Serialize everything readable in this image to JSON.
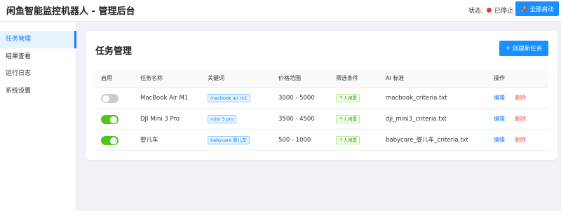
{
  "header": {
    "title": "闲鱼智能监控机器人 - 管理后台",
    "status_label": "状态:",
    "status_value": "已停止",
    "start_all_label": "全部启动",
    "start_icon": "rocket-icon"
  },
  "sidebar": {
    "items": [
      {
        "label": "任务管理",
        "active": true
      },
      {
        "label": "结果查看",
        "active": false
      },
      {
        "label": "运行日志",
        "active": false
      },
      {
        "label": "系统设置",
        "active": false
      }
    ]
  },
  "main": {
    "title": "任务管理",
    "create_label": "创建新任务",
    "columns": [
      "启用",
      "任务名称",
      "关键词",
      "价格范围",
      "筛选条件",
      "AI 标准",
      "操作"
    ],
    "rows": [
      {
        "enabled": false,
        "name": "MacBook Air M1",
        "keyword": "macbook air m1",
        "price": "3000 - 5000",
        "filter": "个人闲置",
        "ai": "macbook_criteria.txt",
        "edit": "编辑",
        "delete": "删除"
      },
      {
        "enabled": true,
        "name": "DJI Mini 3 Pro",
        "keyword": "mini 3 pro",
        "price": "3500 - 4500",
        "filter": "个人闲置",
        "ai": "dji_mini3_criteria.txt",
        "edit": "编辑",
        "delete": "删除"
      },
      {
        "enabled": true,
        "name": "婴儿车",
        "keyword": "babycare 婴儿车",
        "price": "500 - 1000",
        "filter": "个人闲置",
        "ai": "babycare_婴儿车_criteria.txt",
        "edit": "编辑",
        "delete": "删除"
      }
    ]
  },
  "colors": {
    "primary": "#1890ff",
    "status_stopped": "#e53935",
    "toggle_on": "#52c41a",
    "toggle_off": "#cccccc",
    "danger": "#ff4d4f"
  }
}
